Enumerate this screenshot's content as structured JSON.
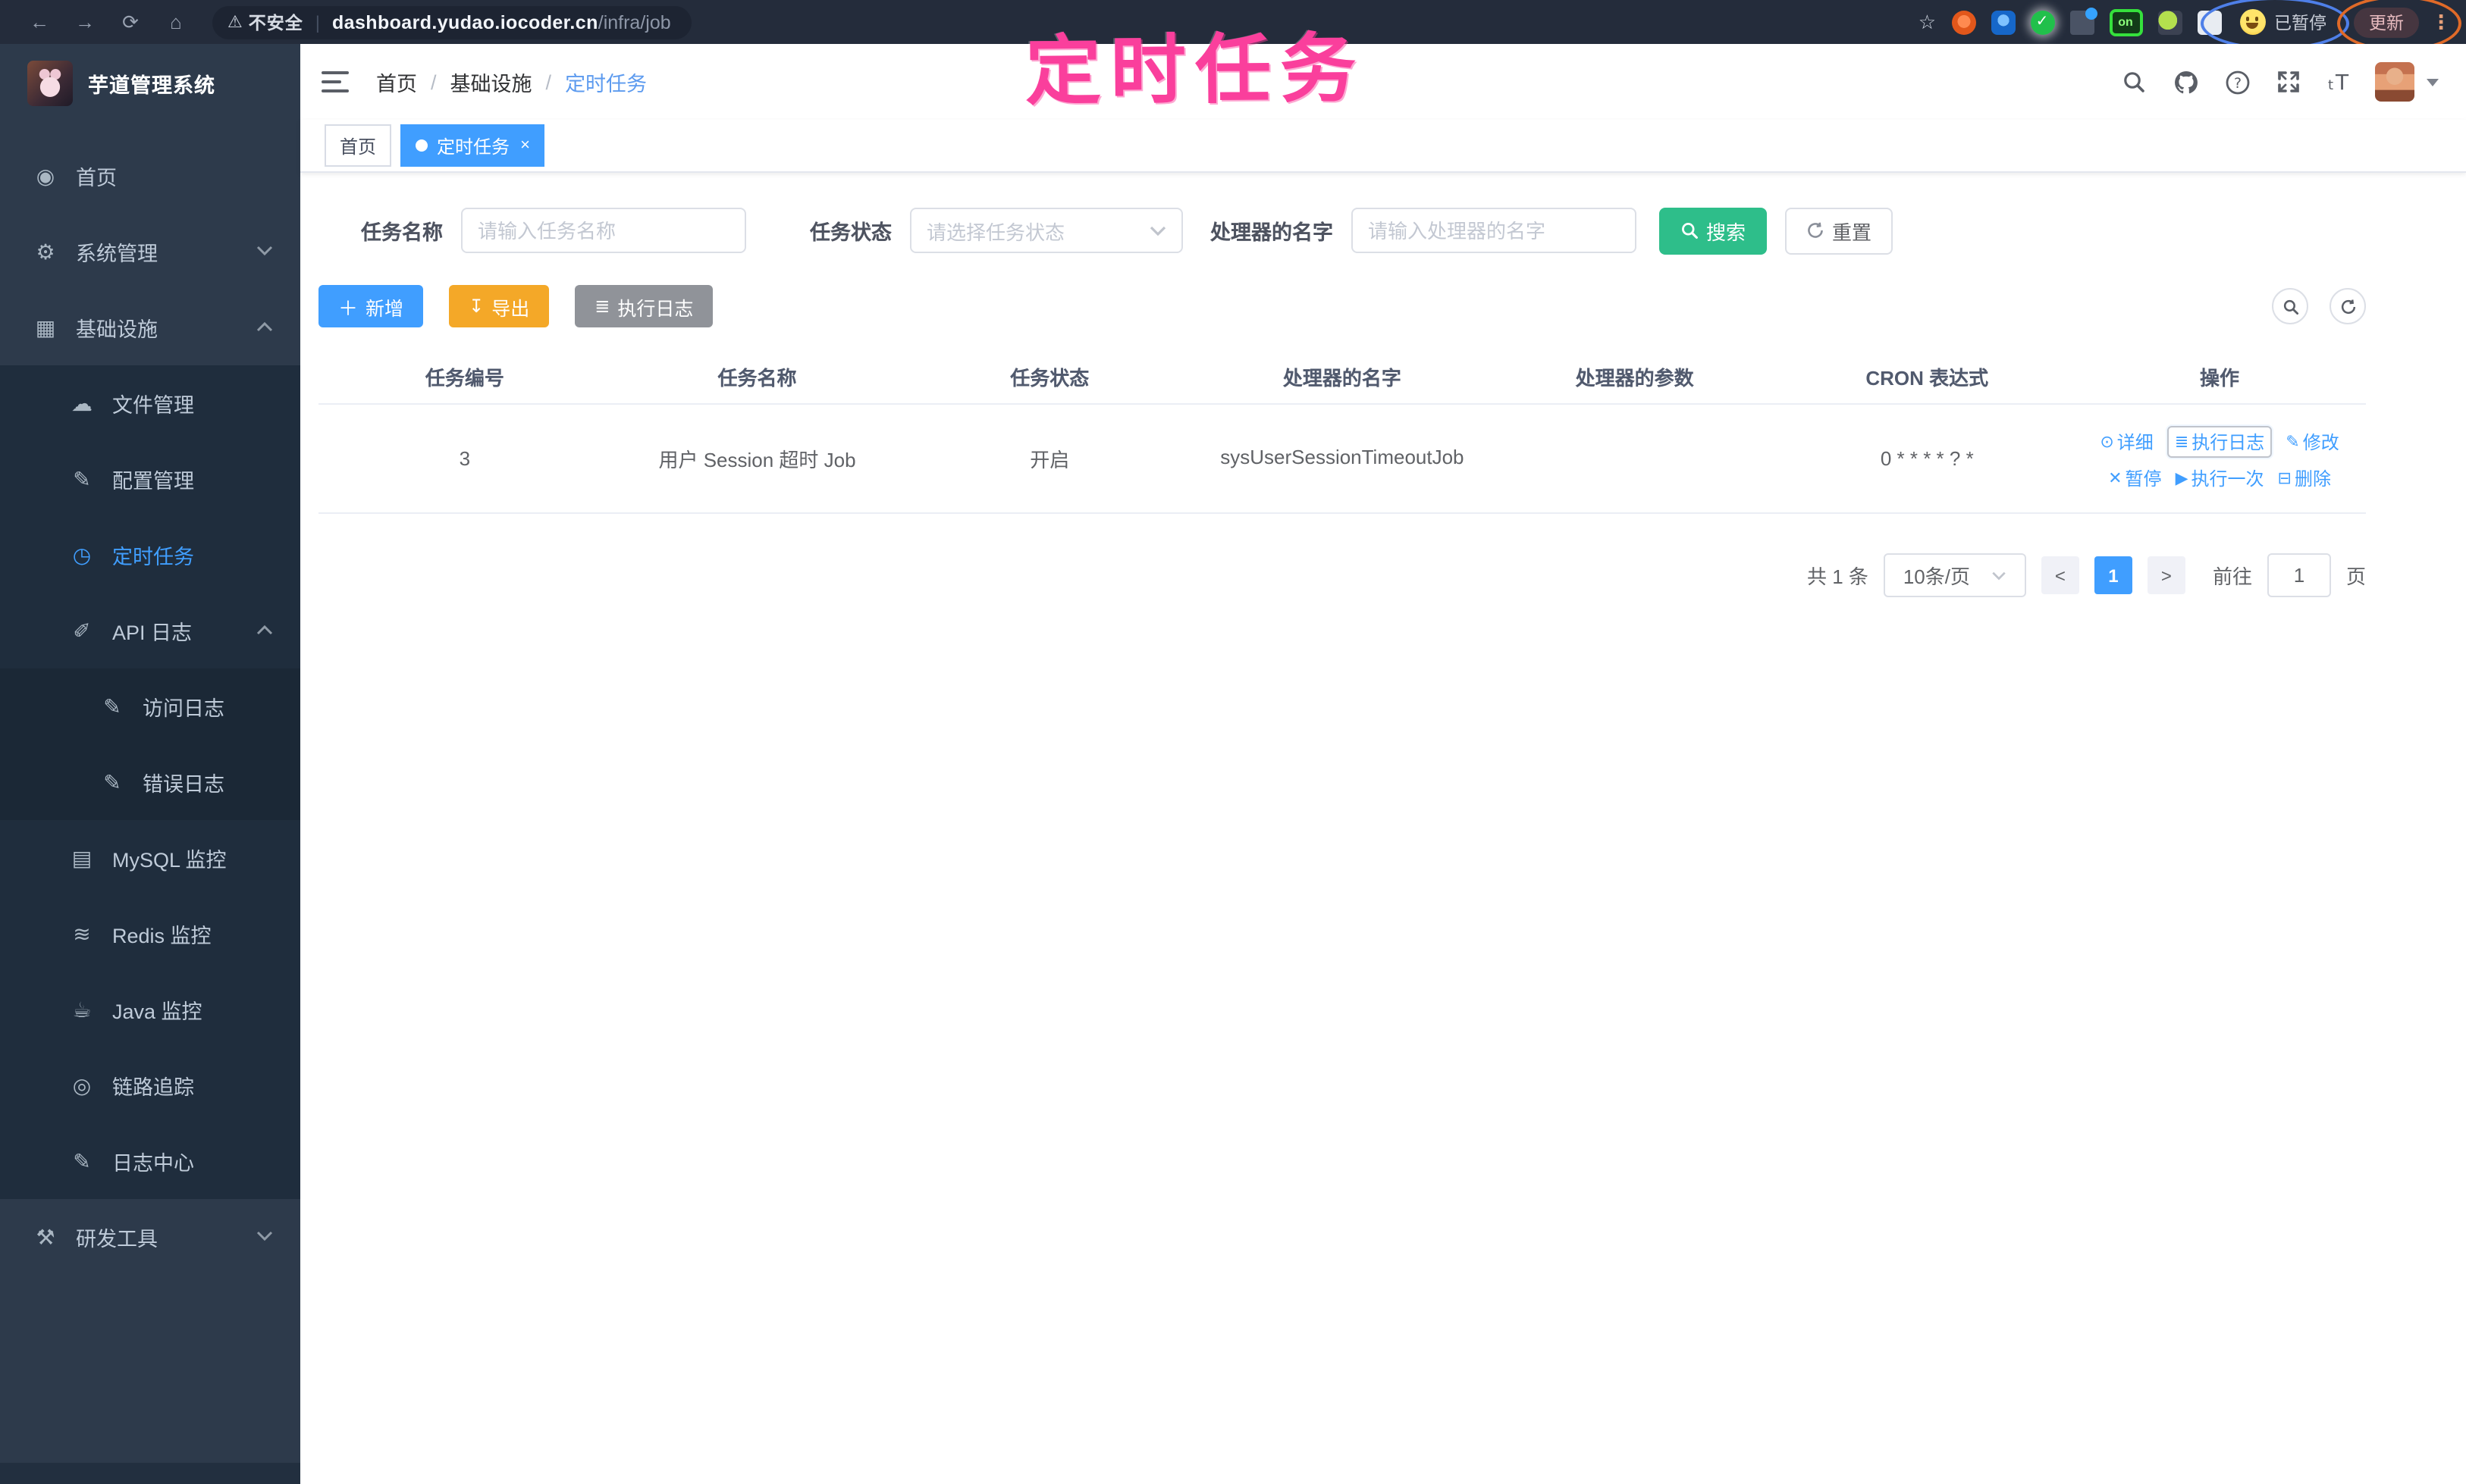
{
  "browser": {
    "security_warning": "不安全",
    "url_host": "dashboard.yudao.iocoder.cn",
    "url_path": "/infra/job",
    "on_badge": "on",
    "paused_badge": "已暂停",
    "update_button": "更新"
  },
  "annotation": {
    "watermark": "定时任务"
  },
  "colors": {
    "accent_blue": "#409eff",
    "search_green": "#2ebe8a",
    "export_amber": "#f4a828",
    "info_gray": "#909399",
    "sidebar_bg": "#2d3a4b",
    "submenu_bg": "#1f2d3d",
    "watermark_pink": "#fa3f9c"
  },
  "sidebar": {
    "title": "芋道管理系统",
    "items": [
      {
        "label": "首页",
        "icon": "dashboard-icon",
        "level": 1
      },
      {
        "label": "系统管理",
        "icon": "gear-icon",
        "level": 1,
        "arrow": "down"
      },
      {
        "label": "基础设施",
        "icon": "infrastructure-icon",
        "level": 1,
        "arrow": "up"
      },
      {
        "label": "文件管理",
        "icon": "cloud-upload-icon",
        "level": 2
      },
      {
        "label": "配置管理",
        "icon": "edit-square-icon",
        "level": 2
      },
      {
        "label": "定时任务",
        "icon": "clock-icon",
        "level": 2,
        "active": true
      },
      {
        "label": "API 日志",
        "icon": "api-log-icon",
        "level": 2,
        "arrow": "up"
      },
      {
        "label": "访问日志",
        "icon": "doc-edit-icon",
        "level": 3
      },
      {
        "label": "错误日志",
        "icon": "doc-edit-icon",
        "level": 3
      },
      {
        "label": "MySQL 监控",
        "icon": "mysql-icon",
        "level": 2
      },
      {
        "label": "Redis 监控",
        "icon": "redis-icon",
        "level": 2
      },
      {
        "label": "Java 监控",
        "icon": "java-icon",
        "level": 2
      },
      {
        "label": "链路追踪",
        "icon": "trace-icon",
        "level": 2
      },
      {
        "label": "日志中心",
        "icon": "log-center-icon",
        "level": 2
      },
      {
        "label": "研发工具",
        "icon": "toolbox-icon",
        "level": 1,
        "arrow": "down"
      }
    ]
  },
  "header": {
    "breadcrumb": [
      "首页",
      "基础设施",
      "定时任务"
    ]
  },
  "tabs": [
    {
      "label": "首页",
      "active": false,
      "closable": false
    },
    {
      "label": "定时任务",
      "active": true,
      "closable": true
    }
  ],
  "filters": {
    "job_name_label": "任务名称",
    "job_name_placeholder": "请输入任务名称",
    "job_status_label": "任务状态",
    "job_status_placeholder": "请选择任务状态",
    "handler_label": "处理器的名字",
    "handler_placeholder": "请输入处理器的名字",
    "search_label": "搜索",
    "reset_label": "重置"
  },
  "toolbar": {
    "add_label": "新增",
    "export_label": "导出",
    "exec_log_label": "执行日志"
  },
  "table": {
    "columns": [
      "任务编号",
      "任务名称",
      "任务状态",
      "处理器的名字",
      "处理器的参数",
      "CRON 表达式",
      "操作"
    ],
    "rows": [
      {
        "id": "3",
        "name": "用户 Session 超时 Job",
        "status": "开启",
        "handler": "sysUserSessionTimeoutJob",
        "param": "",
        "cron": "0 * * * * ? *",
        "actions": [
          [
            {
              "label": "详细",
              "icon": "eye-icon"
            },
            {
              "label": "执行日志",
              "icon": "list-icon",
              "focused": true
            },
            {
              "label": "修改",
              "icon": "edit-icon"
            }
          ],
          [
            {
              "label": "暂停",
              "icon": "pause-icon"
            },
            {
              "label": "执行一次",
              "icon": "play-icon"
            },
            {
              "label": "删除",
              "icon": "delete-icon"
            }
          ]
        ]
      }
    ]
  },
  "pagination": {
    "total_text": "共 1 条",
    "page_size_text": "10条/页",
    "prev_label": "<",
    "current_page": "1",
    "next_label": ">",
    "goto_label": "前往",
    "goto_value": "1",
    "page_suffix": "页"
  }
}
